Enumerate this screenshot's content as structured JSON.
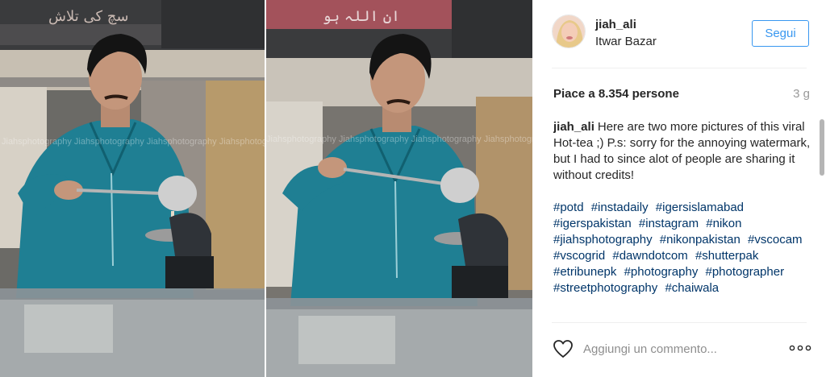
{
  "post": {
    "username": "jiah_ali",
    "location": "Itwar Bazar",
    "follow_label": "Segui",
    "likes": "Piace a 8.354 persone",
    "time": "3 g",
    "caption_user": "jiah_ali",
    "caption_text": "Here are two more pictures of this viral Hot-tea ;) P.s: sorry for the annoying watermark, but I had to since alot of people are sharing it without credits!",
    "hashtags": [
      "#potd",
      "#instadaily",
      "#igersislamabad",
      "#igerspakistan",
      "#instagram",
      "#nikon",
      "#jiahsphotography",
      "#nikonpakistan",
      "#vscocam",
      "#vscogrid",
      "#dawndotcom",
      "#shutterpak",
      "#etribunepk",
      "#photography",
      "#photographer",
      "#streetphotography",
      "#chaiwala"
    ],
    "comment_placeholder": "Aggiungi un commento...",
    "watermark": "Jiahsphotography Jiahsphotography Jiahsphotography Jiahsphotography"
  },
  "icons": {
    "like": "heart-icon",
    "options": "more-options-icon"
  },
  "colors": {
    "accent": "#3897f0",
    "hashtag": "#003569",
    "muted": "#999999"
  }
}
